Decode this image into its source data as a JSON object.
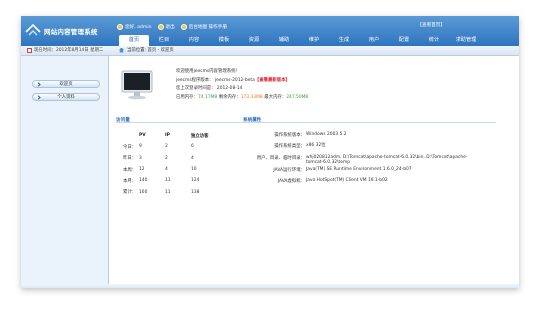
{
  "header": {
    "logo_text": "网站内容管理系统",
    "links": [
      {
        "label": "您好, admin"
      },
      {
        "label": "退出"
      },
      {
        "label": "后台地图 操作手册"
      }
    ],
    "site_home": "【查看首页】"
  },
  "nav": {
    "tabs": [
      "首页",
      "栏目",
      "内容",
      "模板",
      "资源",
      "辅助",
      "维护",
      "生成",
      "用户",
      "配置",
      "统计",
      "求助管理"
    ]
  },
  "subbar": {
    "date_text": "现在时间：2012年8月14日 星期二",
    "breadcrumb": "当前位置: 首页 - 欢迎页"
  },
  "sidebar": {
    "items": [
      {
        "label": "欢迎页"
      },
      {
        "label": "个人资料"
      }
    ]
  },
  "welcome": {
    "line1": "欢迎使用jeecms内容管理系统!",
    "line2_prefix": "jeecms程序版本： jeecms-2012-beta",
    "line2_link": "【查看最新版本】",
    "line3": "您上次登录时间是： 2012-08-14",
    "mem_used_label": "已用内存：",
    "mem_used": "74.17MB",
    "mem_free_label": "剩余内存：",
    "mem_free": "173.33MB",
    "mem_max_label": "最大内存：",
    "mem_max": "247.50MB"
  },
  "visits": {
    "section_title": "访问量",
    "headers": [
      "",
      "PV",
      "IP",
      "独立访客"
    ],
    "rows": [
      [
        "今日：",
        "9",
        "2",
        "6"
      ],
      [
        "昨日：",
        "3",
        "2",
        "4"
      ],
      [
        "本周：",
        "12",
        "4",
        "10"
      ],
      [
        "本月：",
        "140",
        "11",
        "124"
      ],
      [
        "累计：",
        "160",
        "11",
        "138"
      ]
    ]
  },
  "system": {
    "section_title": "系统属性",
    "props": [
      {
        "label": "操作系统版本：",
        "value": "Windows 2003 5.2"
      },
      {
        "label": "操作系统类型：",
        "value": "x86 32位"
      },
      {
        "label": "用户、目录、临时目录：",
        "value": "whj020812adm, D:\\Tomcat\\apache-tomcat-6.0.32\\bin, D:\\Tomcat\\apache-tomcat-6.0.32\\temp"
      },
      {
        "label": "JAVA运行环境：",
        "value": "Java(TM) SE Runtime Environment 1.6.0_24-b07"
      },
      {
        "label": "JAVA虚拟机：",
        "value": "Java HotSpot(TM) Client VM 19.1-b02"
      }
    ]
  }
}
